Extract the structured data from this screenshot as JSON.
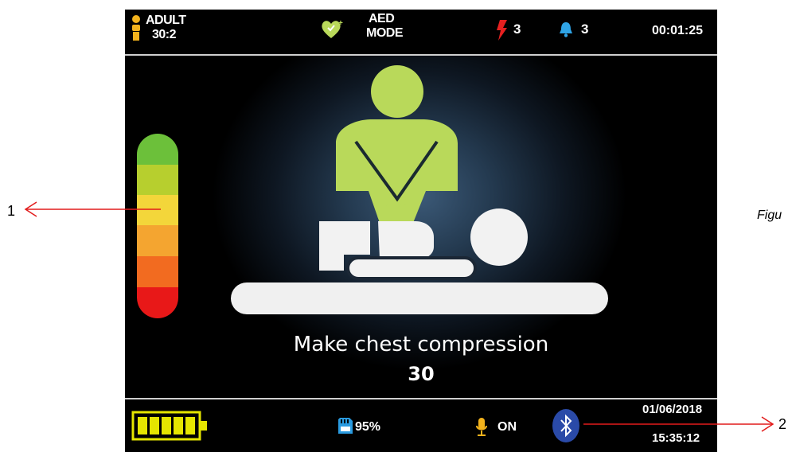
{
  "status_bar": {
    "patient_type": "ADULT",
    "ratio": "30:2",
    "mode_line1": "AED",
    "mode_line2": "MODE",
    "shock_count": "3",
    "alarm_count": "3",
    "elapsed_time": "00:01:25"
  },
  "main": {
    "instruction": "Make chest compression",
    "count": "30",
    "depth_gauge_colors": [
      "#6cc03a",
      "#b7cf2e",
      "#f3d63a",
      "#f4a530",
      "#f26b20",
      "#e81818"
    ]
  },
  "bottom_bar": {
    "battery_bars": 5,
    "storage": "95%",
    "mic_status": "ON",
    "date": "01/06/2018",
    "time": "15:35:12"
  },
  "annotations": {
    "label_1": "1",
    "label_2": "2",
    "figure_caption": "Figu"
  },
  "colors": {
    "accent_yellow_green": "#b9d95a",
    "figure_white": "#f2f2f2",
    "annotation_arrow": "#e21b1b",
    "battery": "#e5e500",
    "bluetooth": "#2a4aa8"
  }
}
